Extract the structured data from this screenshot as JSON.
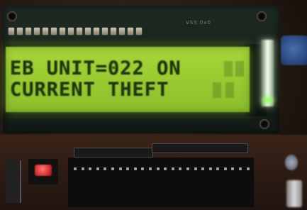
{
  "lcd": {
    "line1": "EB UNIT=022 ON",
    "line2": "CURRENT THEFT",
    "backlight_color": "#a6d63a",
    "text_color": "#1d3512"
  },
  "board": {
    "silkscreen_label": "VSS 0x0"
  },
  "icons": {
    "reset_button": "red-push-button-icon",
    "potentiometer": "contrast-pot-icon",
    "ic_socket": "chip-socket-icon"
  }
}
